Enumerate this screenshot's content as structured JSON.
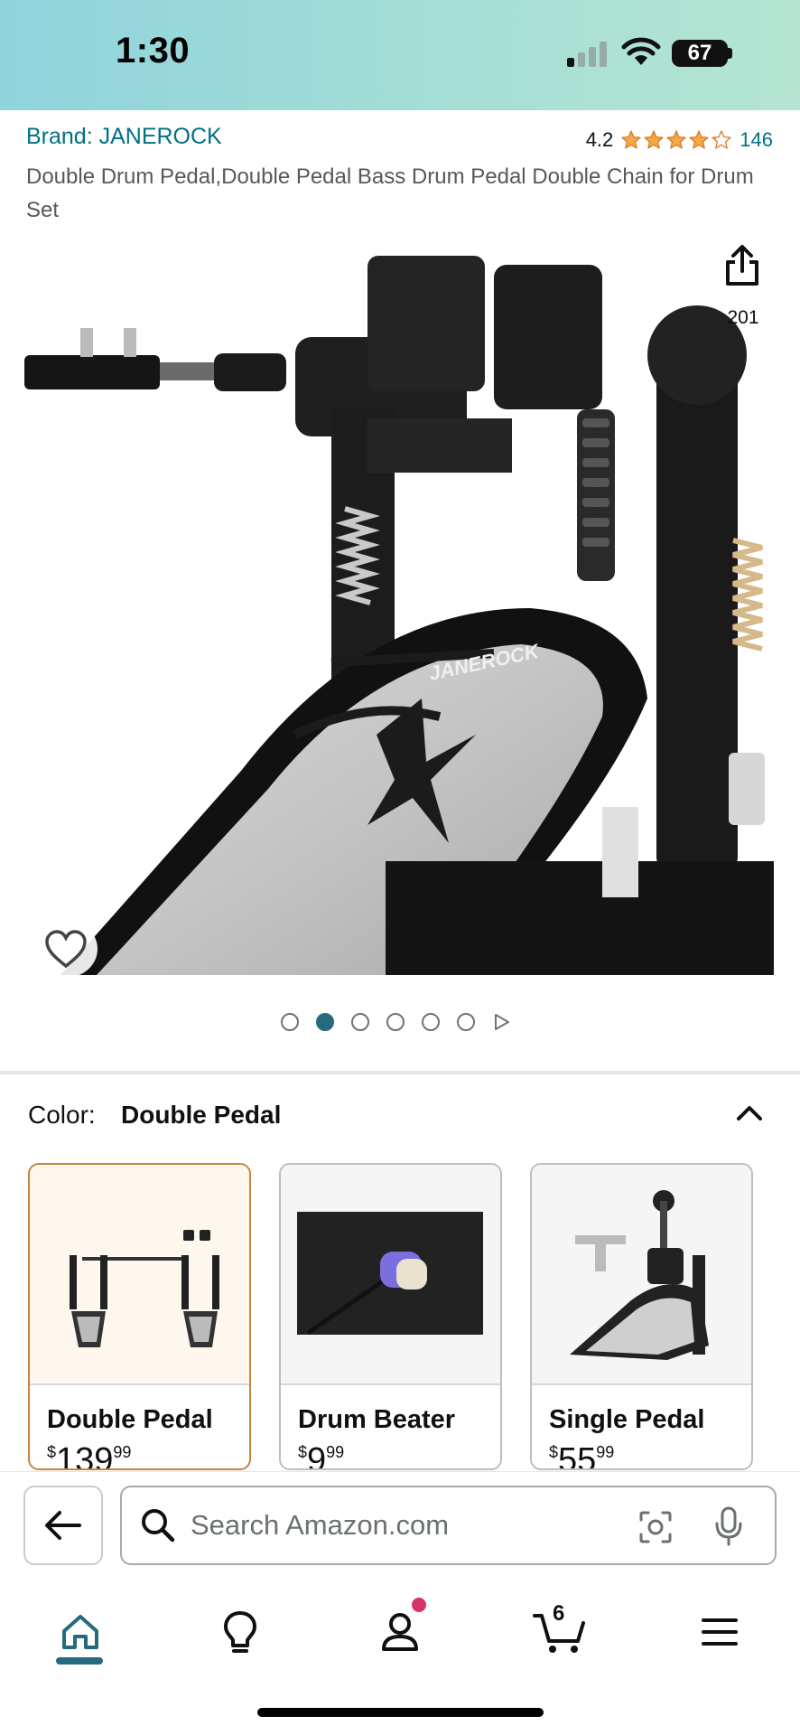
{
  "status_bar": {
    "time": "1:30",
    "battery": "67"
  },
  "product": {
    "brand": "Brand: JANEROCK",
    "rating": "4.2",
    "rating_stars": 4.2,
    "rating_count": "146",
    "title": "Double Drum Pedal,Double Pedal Bass Drum Pedal Double Chain for Drum Set",
    "image_watermark": "JANEROCK",
    "share_count": "201"
  },
  "gallery": {
    "total_dots": 6,
    "active_index": 1
  },
  "color": {
    "label": "Color:",
    "selected": "Double Pedal",
    "variants": [
      {
        "name": "Double Pedal",
        "currency": "$",
        "price_whole": "139",
        "price_fraction": "99",
        "selected": true
      },
      {
        "name": "Drum Beater",
        "currency": "$",
        "price_whole": "9",
        "price_fraction": "99",
        "selected": false
      },
      {
        "name": "Single Pedal",
        "currency": "$",
        "price_whole": "55",
        "price_fraction": "99",
        "selected": false
      }
    ]
  },
  "search": {
    "placeholder": "Search Amazon.com"
  },
  "nav": {
    "cart_count": "6",
    "items": [
      "home-icon",
      "lightbulb-icon",
      "account-icon",
      "cart-icon",
      "menu-icon"
    ]
  },
  "colors": {
    "link": "#007185",
    "accent": "#266A7D",
    "star": "#F3A847",
    "selected_border": "#C7853D",
    "badge": "#D6336C"
  }
}
